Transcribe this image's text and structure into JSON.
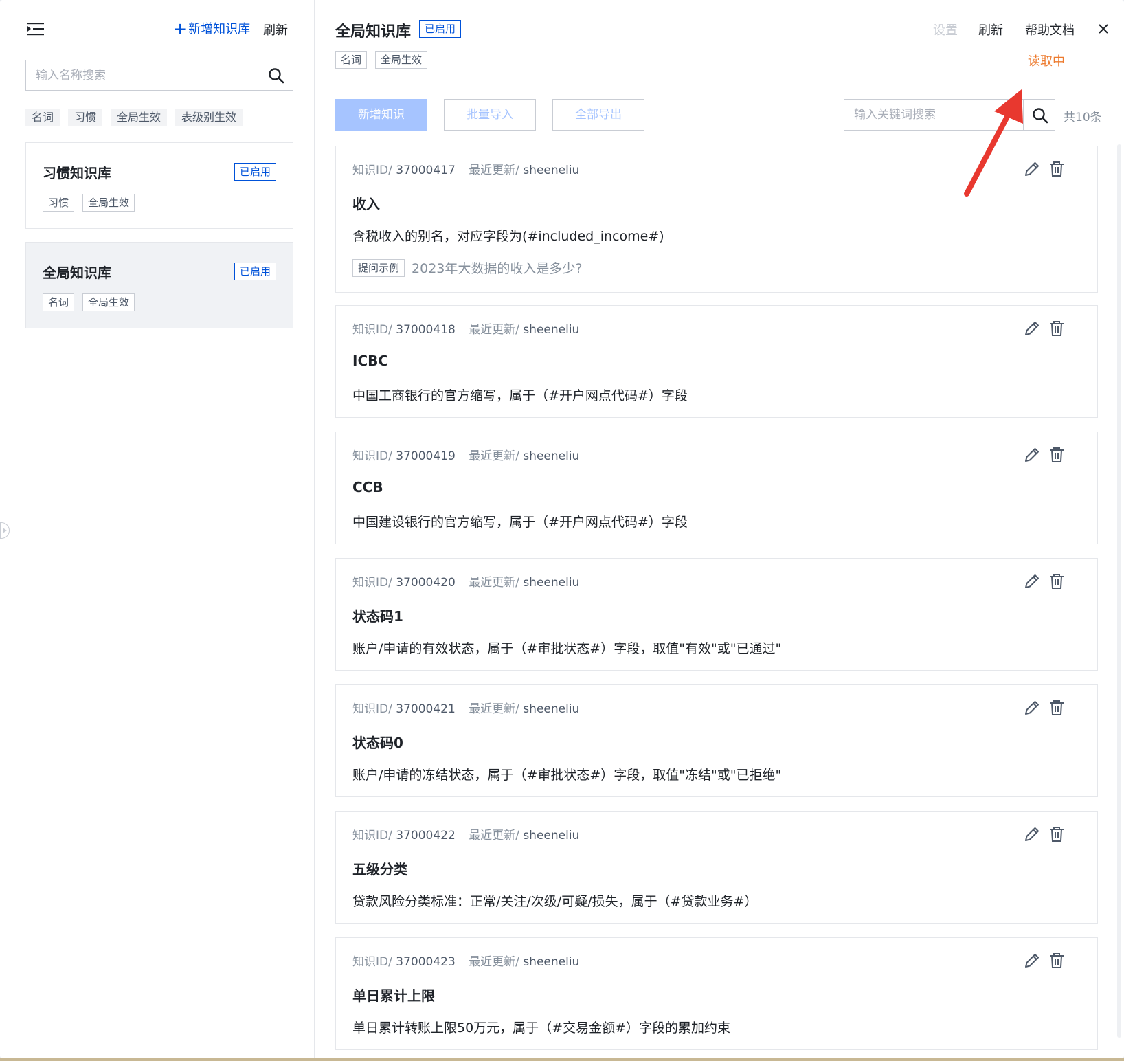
{
  "left_panel": {
    "add_kb_label": "新增知识库",
    "refresh_label": "刷新",
    "search_placeholder": "输入名称搜索",
    "filter_tags": [
      "名词",
      "习惯",
      "全局生效",
      "表级别生效"
    ],
    "kb_list": [
      {
        "name": "习惯知识库",
        "status": "已启用",
        "tags": [
          "习惯",
          "全局生效"
        ]
      },
      {
        "name": "全局知识库",
        "status": "已启用",
        "tags": [
          "名词",
          "全局生效"
        ]
      }
    ]
  },
  "header": {
    "title": "全局知识库",
    "status": "已启用",
    "tags": [
      "名词",
      "全局生效"
    ],
    "settings_label": "设置",
    "refresh_label": "刷新",
    "help_label": "帮助文档",
    "loading_text": "读取中"
  },
  "toolbar": {
    "add_label": "新增知识",
    "import_label": "批量导入",
    "export_label": "全部导出",
    "search_placeholder": "输入关键词搜索",
    "total": "共10条"
  },
  "knowledge_items": [
    {
      "id_label": "知识ID/",
      "id": "37000417",
      "updated_label": "最近更新/",
      "updated_by": "sheeneliu",
      "term": "收入",
      "description": "含税收入的别名，对应字段为(#included_income#)",
      "example_label": "提问示例",
      "example": "2023年大数据的收入是多少?"
    },
    {
      "id_label": "知识ID/",
      "id": "37000418",
      "updated_label": "最近更新/",
      "updated_by": "sheeneliu",
      "term": "ICBC",
      "description": "中国工商银行的官方缩写，属于（#开户网点代码#）字段"
    },
    {
      "id_label": "知识ID/",
      "id": "37000419",
      "updated_label": "最近更新/",
      "updated_by": "sheeneliu",
      "term": "CCB",
      "description": "中国建设银行的官方缩写，属于（#开户网点代码#）字段"
    },
    {
      "id_label": "知识ID/",
      "id": "37000420",
      "updated_label": "最近更新/",
      "updated_by": "sheeneliu",
      "term": "状态码1",
      "description": "账户/申请的有效状态，属于（#审批状态#）字段，取值\"有效\"或\"已通过\""
    },
    {
      "id_label": "知识ID/",
      "id": "37000421",
      "updated_label": "最近更新/",
      "updated_by": "sheeneliu",
      "term": "状态码0",
      "description": "账户/申请的冻结状态，属于（#审批状态#）字段，取值\"冻结\"或\"已拒绝\""
    },
    {
      "id_label": "知识ID/",
      "id": "37000422",
      "updated_label": "最近更新/",
      "updated_by": "sheeneliu",
      "term": "五级分类",
      "description": "贷款风险分类标准：正常/关注/次级/可疑/损失，属于（#贷款业务#）"
    },
    {
      "id_label": "知识ID/",
      "id": "37000423",
      "updated_label": "最近更新/",
      "updated_by": "sheeneliu",
      "term": "单日累计上限",
      "description": "单日累计转账上限50万元，属于（#交易金额#）字段的累加约束"
    }
  ],
  "icons": {
    "menu": "menu-fold-icon",
    "search": "search-icon",
    "close": "close-icon",
    "edit": "edit-icon",
    "delete": "delete-icon",
    "annotation": "red-arrow"
  },
  "colors": {
    "brand": "#0052d9",
    "primary_disabled": "#a6c4ff",
    "loading": "#ed7b2f",
    "annotation": "#e8382f"
  }
}
